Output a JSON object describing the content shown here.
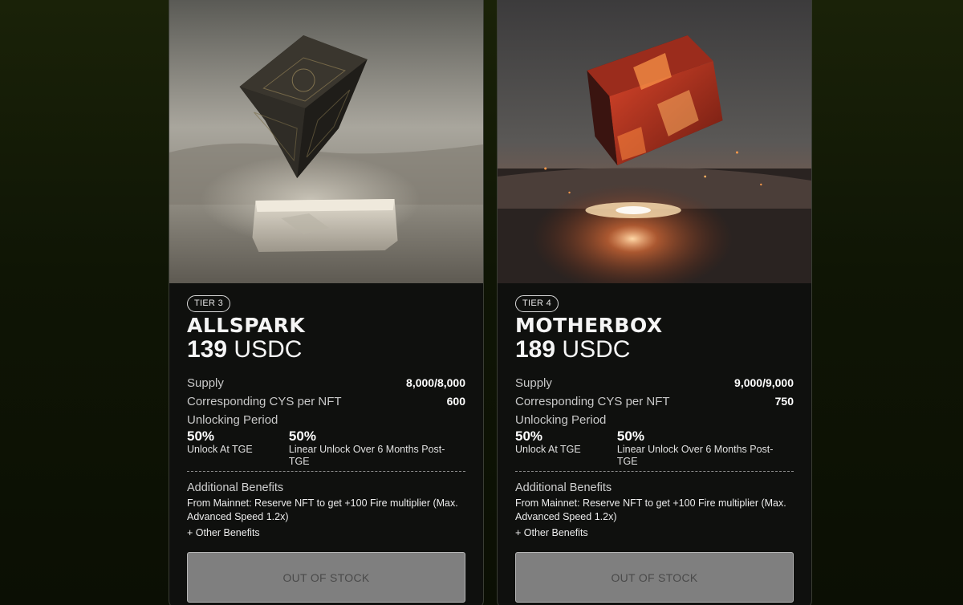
{
  "cards": [
    {
      "tier": "TIER 3",
      "name": "ALLSPARK",
      "price_amount": "139",
      "price_unit": "USDC",
      "supply_label": "Supply",
      "supply_value": "8,000/8,000",
      "cys_label": "Corresponding CYS per NFT",
      "cys_value": "600",
      "unlocking_label": "Unlocking Period",
      "unlock_a_pct": "50%",
      "unlock_a_desc": "Unlock At TGE",
      "unlock_b_pct": "50%",
      "unlock_b_desc": "Linear Unlock Over 6 Months Post-TGE",
      "benefits_title": "Additional Benefits",
      "benefits_text": "From Mainnet: Reserve NFT to get +100 Fire multiplier (Max. Advanced Speed 1.2x)",
      "other_benefits": "+ Other Benefits",
      "button_label": "OUT OF STOCK"
    },
    {
      "tier": "TIER 4",
      "name": "MOTHERBOX",
      "price_amount": "189",
      "price_unit": "USDC",
      "supply_label": "Supply",
      "supply_value": "9,000/9,000",
      "cys_label": "Corresponding CYS per NFT",
      "cys_value": "750",
      "unlocking_label": "Unlocking Period",
      "unlock_a_pct": "50%",
      "unlock_a_desc": "Unlock At TGE",
      "unlock_b_pct": "50%",
      "unlock_b_desc": "Linear Unlock Over 6 Months Post-TGE",
      "benefits_title": "Additional Benefits",
      "benefits_text": "From Mainnet: Reserve NFT to get +100 Fire multiplier (Max. Advanced Speed 1.2x)",
      "other_benefits": "+ Other Benefits",
      "button_label": "OUT OF STOCK"
    }
  ],
  "icons": {
    "card_1_art": "floating-stone-cube-image",
    "card_2_art": "glowing-lava-cube-image"
  }
}
